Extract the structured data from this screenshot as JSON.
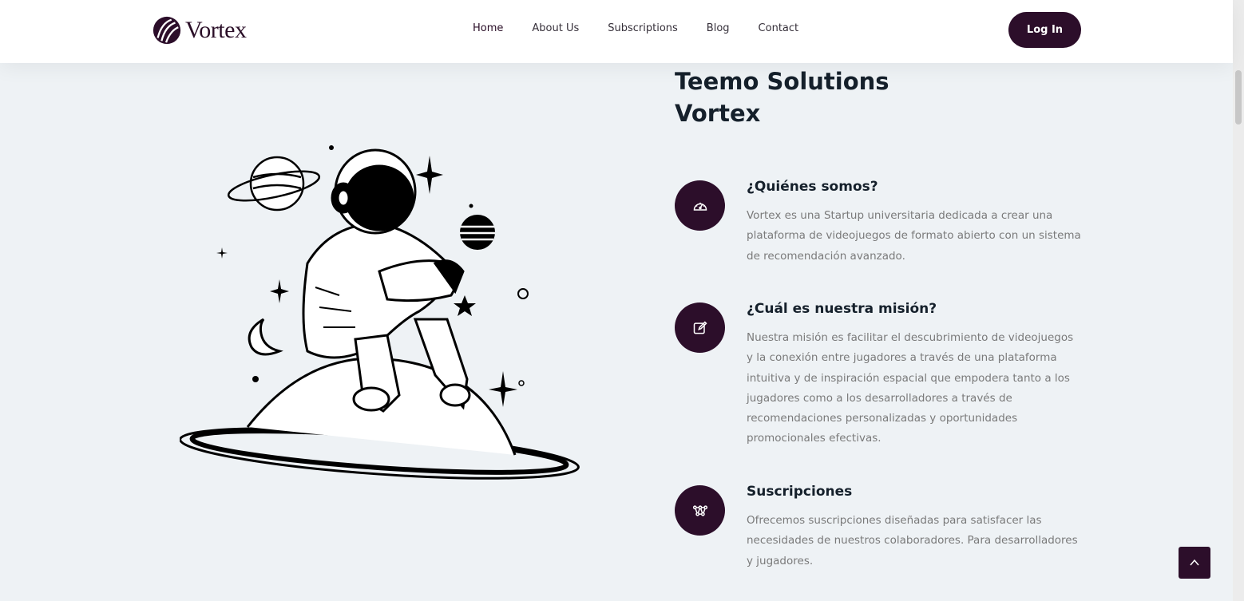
{
  "brand": {
    "name": "Vortex"
  },
  "nav": {
    "items": [
      {
        "label": "Home"
      },
      {
        "label": "About Us"
      },
      {
        "label": "Subscriptions"
      },
      {
        "label": "Blog"
      },
      {
        "label": "Contact"
      }
    ],
    "login_label": "Log In"
  },
  "about": {
    "title_line1": "Teemo Solutions",
    "title_line2": "Vortex",
    "features": [
      {
        "icon": "speedometer-icon",
        "title": "¿Quiénes somos?",
        "text": "Vortex es una Startup universitaria dedicada a crear una plataforma de videojuegos de formato abierto con un sistema de recomendación avanzado."
      },
      {
        "icon": "edit-icon",
        "title": "¿Cuál es nuestra misión?",
        "text": "Nuestra misión es facilitar el descubrimiento de videojuegos y la conexión entre jugadores a través de una plataforma intuitiva y de inspiración espacial que empodera tanto a los jugadores como a los desarrolladores a través de recomendaciones personalizadas y oportunidades promocionales efectivas."
      },
      {
        "icon": "network-icon",
        "title": "Suscripciones",
        "text": "Ofrecemos suscripciones diseñadas para satisfacer las necesidades de nuestros colaboradores. Para desarrolladores y jugadores."
      }
    ]
  },
  "colors": {
    "accent": "#2c0e2a",
    "background": "#eef2f5",
    "heading": "#15202b",
    "body_text": "#7a7a7a"
  }
}
